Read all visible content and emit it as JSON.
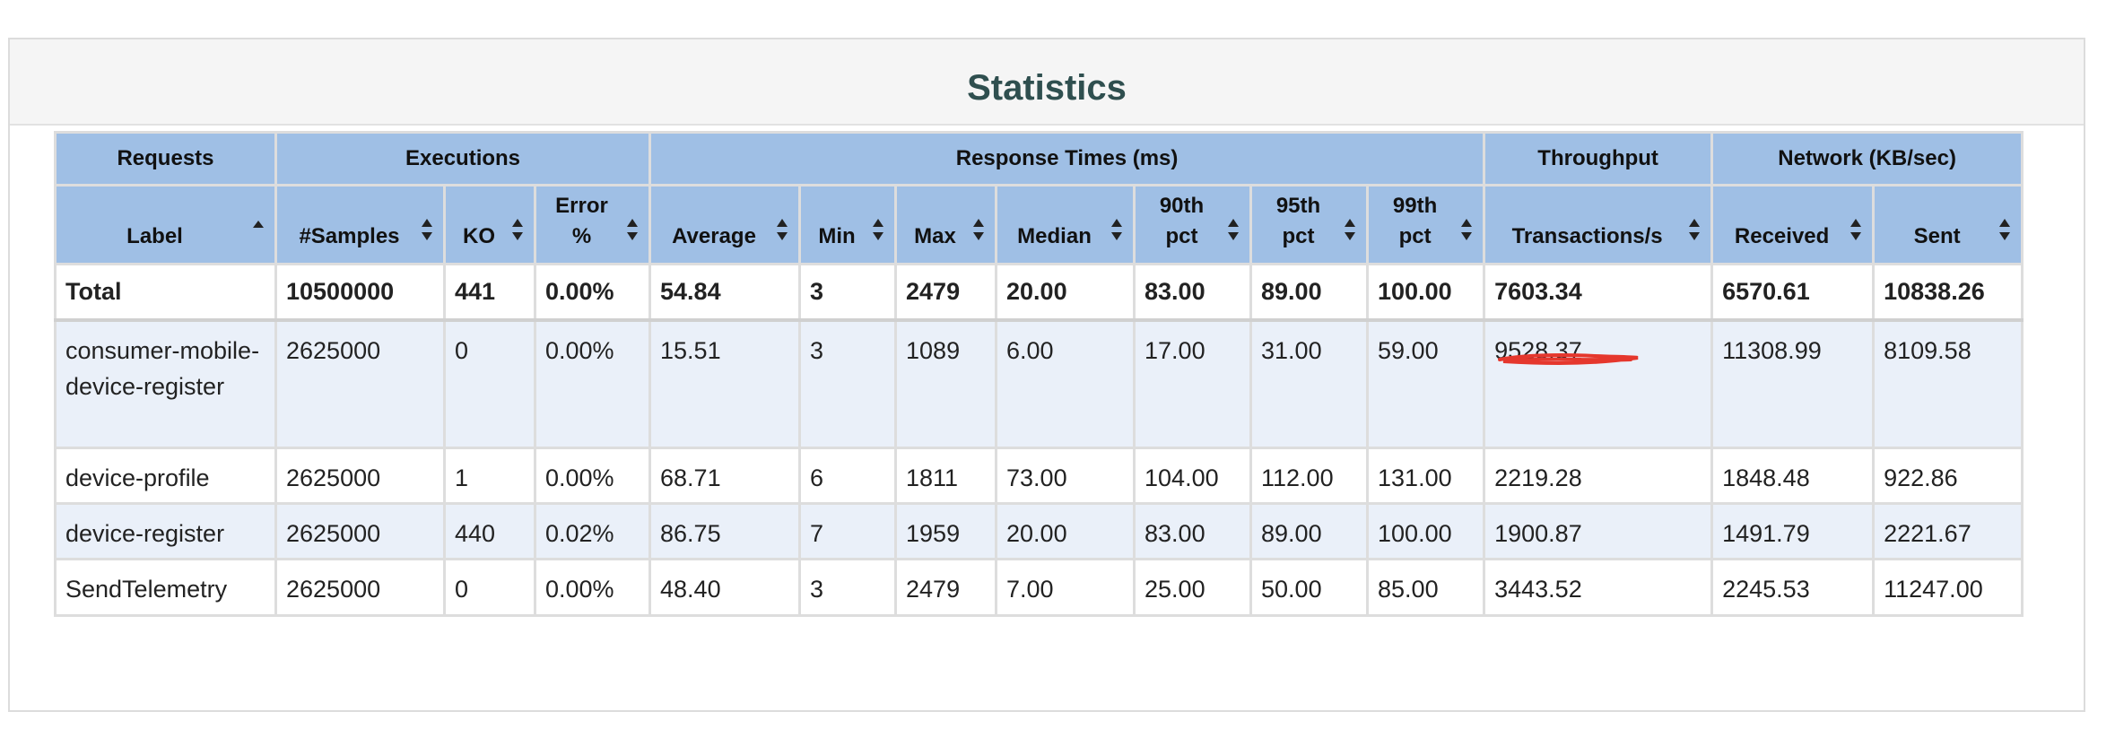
{
  "panel": {
    "title": "Statistics"
  },
  "groups": [
    "Requests",
    "Executions",
    "Response Times (ms)",
    "Throughput",
    "Network (KB/sec)"
  ],
  "columns": [
    {
      "l1": "Label",
      "l2": ""
    },
    {
      "l1": "#Samples",
      "l2": ""
    },
    {
      "l1": "KO",
      "l2": ""
    },
    {
      "l1": "Error",
      "l2": "%"
    },
    {
      "l1": "Average",
      "l2": ""
    },
    {
      "l1": "Min",
      "l2": ""
    },
    {
      "l1": "Max",
      "l2": ""
    },
    {
      "l1": "Median",
      "l2": ""
    },
    {
      "l1": "90th",
      "l2": "pct"
    },
    {
      "l1": "95th",
      "l2": "pct"
    },
    {
      "l1": "99th",
      "l2": "pct"
    },
    {
      "l1": "Transactions/s",
      "l2": ""
    },
    {
      "l1": "Received",
      "l2": ""
    },
    {
      "l1": "Sent",
      "l2": ""
    }
  ],
  "total": [
    "Total",
    "10500000",
    "441",
    "0.00%",
    "54.84",
    "3",
    "2479",
    "20.00",
    "83.00",
    "89.00",
    "100.00",
    "7603.34",
    "6570.61",
    "10838.26"
  ],
  "rows": [
    [
      "consumer-mobile-device-register",
      "2625000",
      "0",
      "0.00%",
      "15.51",
      "3",
      "1089",
      "6.00",
      "17.00",
      "31.00",
      "59.00",
      "9528.37",
      "11308.99",
      "8109.58"
    ],
    [
      "device-profile",
      "2625000",
      "1",
      "0.00%",
      "68.71",
      "6",
      "1811",
      "73.00",
      "104.00",
      "112.00",
      "131.00",
      "2219.28",
      "1848.48",
      "922.86"
    ],
    [
      "device-register",
      "2625000",
      "440",
      "0.02%",
      "86.75",
      "7",
      "1959",
      "20.00",
      "83.00",
      "89.00",
      "100.00",
      "1900.87",
      "1491.79",
      "2221.67"
    ],
    [
      "SendTelemetry",
      "2625000",
      "0",
      "0.00%",
      "48.40",
      "3",
      "2479",
      "7.00",
      "25.00",
      "50.00",
      "85.00",
      "3443.52",
      "2245.53",
      "11247.00"
    ]
  ],
  "colors": {
    "header": "#9fbfe5",
    "stripe": "#eaf0f9",
    "title": "#2f4f4f",
    "annotation": "#e5372d"
  },
  "icons": {
    "sort": "sort-arrows-icon",
    "sort_asc": "sort-ascending-icon"
  }
}
